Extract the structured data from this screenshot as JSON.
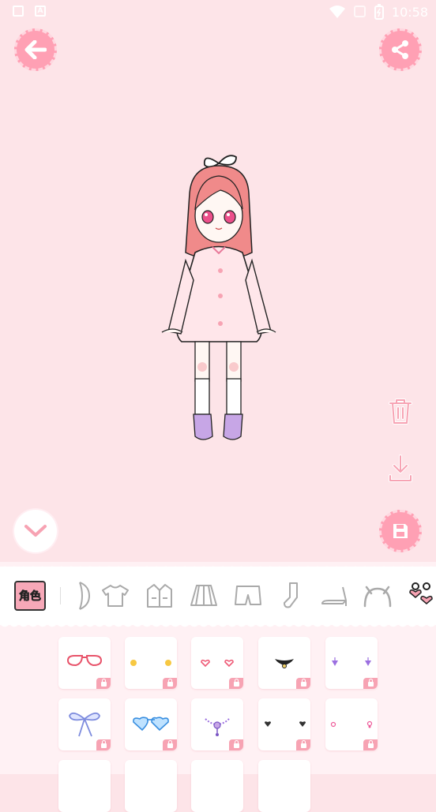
{
  "status_bar": {
    "time": "10:58"
  },
  "colors": {
    "background": "#fde4e8",
    "accent": "#ffa0b4",
    "lock": "#f7a3b3"
  },
  "top_bar": {
    "back_icon": "arrow-left-icon",
    "share_icon": "share-icon"
  },
  "side_tools": [
    "trash-icon",
    "download-icon",
    "save-icon"
  ],
  "collapse_icon": "chevron-down-icon",
  "category_tabs": {
    "active": "角色",
    "items": [
      "sleeve-icon",
      "tshirt-icon",
      "jacket-icon",
      "skirt-icon",
      "shorts-icon",
      "sock-icon",
      "heel-shoe-icon",
      "headband-icon",
      "earring-icon"
    ]
  },
  "accessories": [
    {
      "name": "red-glasses",
      "locked": true
    },
    {
      "name": "yellow-star-studs",
      "locked": true
    },
    {
      "name": "pink-heart-studs",
      "locked": true
    },
    {
      "name": "black-choker",
      "locked": true
    },
    {
      "name": "purple-drop-earrings",
      "locked": true
    },
    {
      "name": "blue-bow",
      "locked": true
    },
    {
      "name": "blue-heart-glasses",
      "locked": true
    },
    {
      "name": "purple-necklace",
      "locked": true
    },
    {
      "name": "black-studs",
      "locked": true
    },
    {
      "name": "pink-studs",
      "locked": true
    }
  ]
}
